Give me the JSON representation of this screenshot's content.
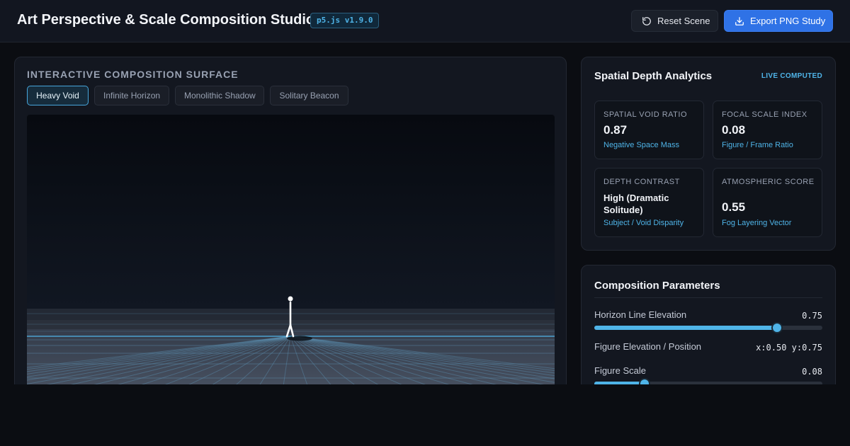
{
  "header": {
    "title": "Art Perspective & Scale Composition Studio",
    "version": "p5.js v1.9.0",
    "reset_label": "Reset Scene",
    "export_label": "Export PNG Study"
  },
  "canvas": {
    "heading": "INTERACTIVE COMPOSITION SURFACE",
    "presets": [
      {
        "label": "Heavy Void",
        "active": true
      },
      {
        "label": "Infinite Horizon",
        "active": false
      },
      {
        "label": "Monolithic Shadow",
        "active": false
      },
      {
        "label": "Solitary Beacon",
        "active": false
      }
    ]
  },
  "analytics": {
    "title": "Spatial Depth Analytics",
    "live_tag": "LIVE COMPUTED",
    "metrics": [
      {
        "label": "SPATIAL VOID RATIO",
        "value": "0.87",
        "sub": "Negative Space Mass"
      },
      {
        "label": "FOCAL SCALE INDEX",
        "value": "0.08",
        "sub": "Figure / Frame Ratio"
      },
      {
        "label": "DEPTH CONTRAST",
        "value": "High (Dramatic Solitude)",
        "sub": "Subject / Void Disparity"
      },
      {
        "label": "ATMOSPHERIC SCORE",
        "value": "0.55",
        "sub": "Fog Layering Vector"
      }
    ]
  },
  "params": {
    "title": "Composition Parameters",
    "horizon": {
      "label": "Horizon Line Elevation",
      "value": "0.75",
      "level": 0.8
    },
    "figure_position": {
      "label": "Figure Elevation / Position",
      "value": "x:0.50 y:0.75"
    },
    "figure_scale": {
      "label": "Figure Scale",
      "value": "0.08",
      "level": 0.22
    }
  },
  "colors": {
    "accent": "#4fb4e8",
    "primary_button": "#2f72e6",
    "background": "#0b0d12",
    "panel": "#131720"
  },
  "icons": {
    "reset": "rotate-ccw-icon",
    "export": "download-icon"
  }
}
